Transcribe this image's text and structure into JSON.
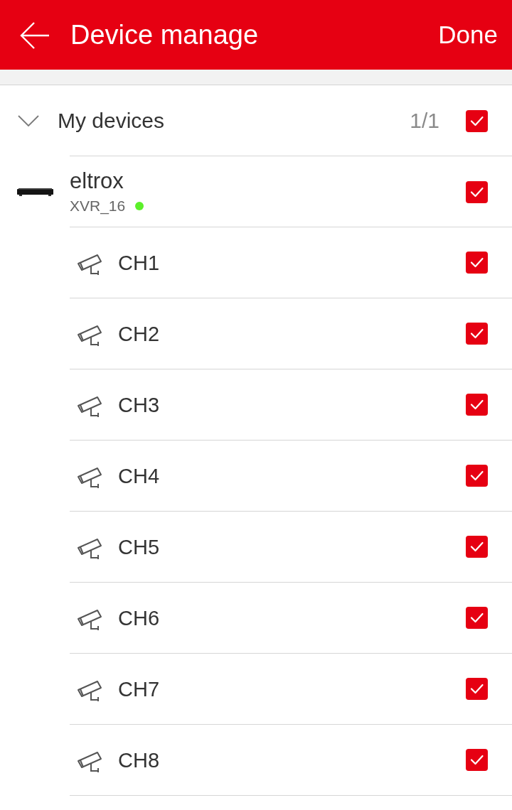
{
  "header": {
    "title": "Device manage",
    "action": "Done"
  },
  "groups": [
    {
      "label": "My devices",
      "count": "1/1",
      "expanded": true,
      "checked": true,
      "children": [
        {
          "name": "eltrox",
          "model": "XVR_16",
          "online": true,
          "checked": true,
          "children": [
            {
              "name": "CH1",
              "checked": true
            },
            {
              "name": "CH2",
              "checked": true
            },
            {
              "name": "CH3",
              "checked": true
            },
            {
              "name": "CH4",
              "checked": true
            },
            {
              "name": "CH5",
              "checked": true
            },
            {
              "name": "CH6",
              "checked": true
            },
            {
              "name": "CH7",
              "checked": true
            },
            {
              "name": "CH8",
              "checked": true
            }
          ]
        }
      ]
    }
  ]
}
